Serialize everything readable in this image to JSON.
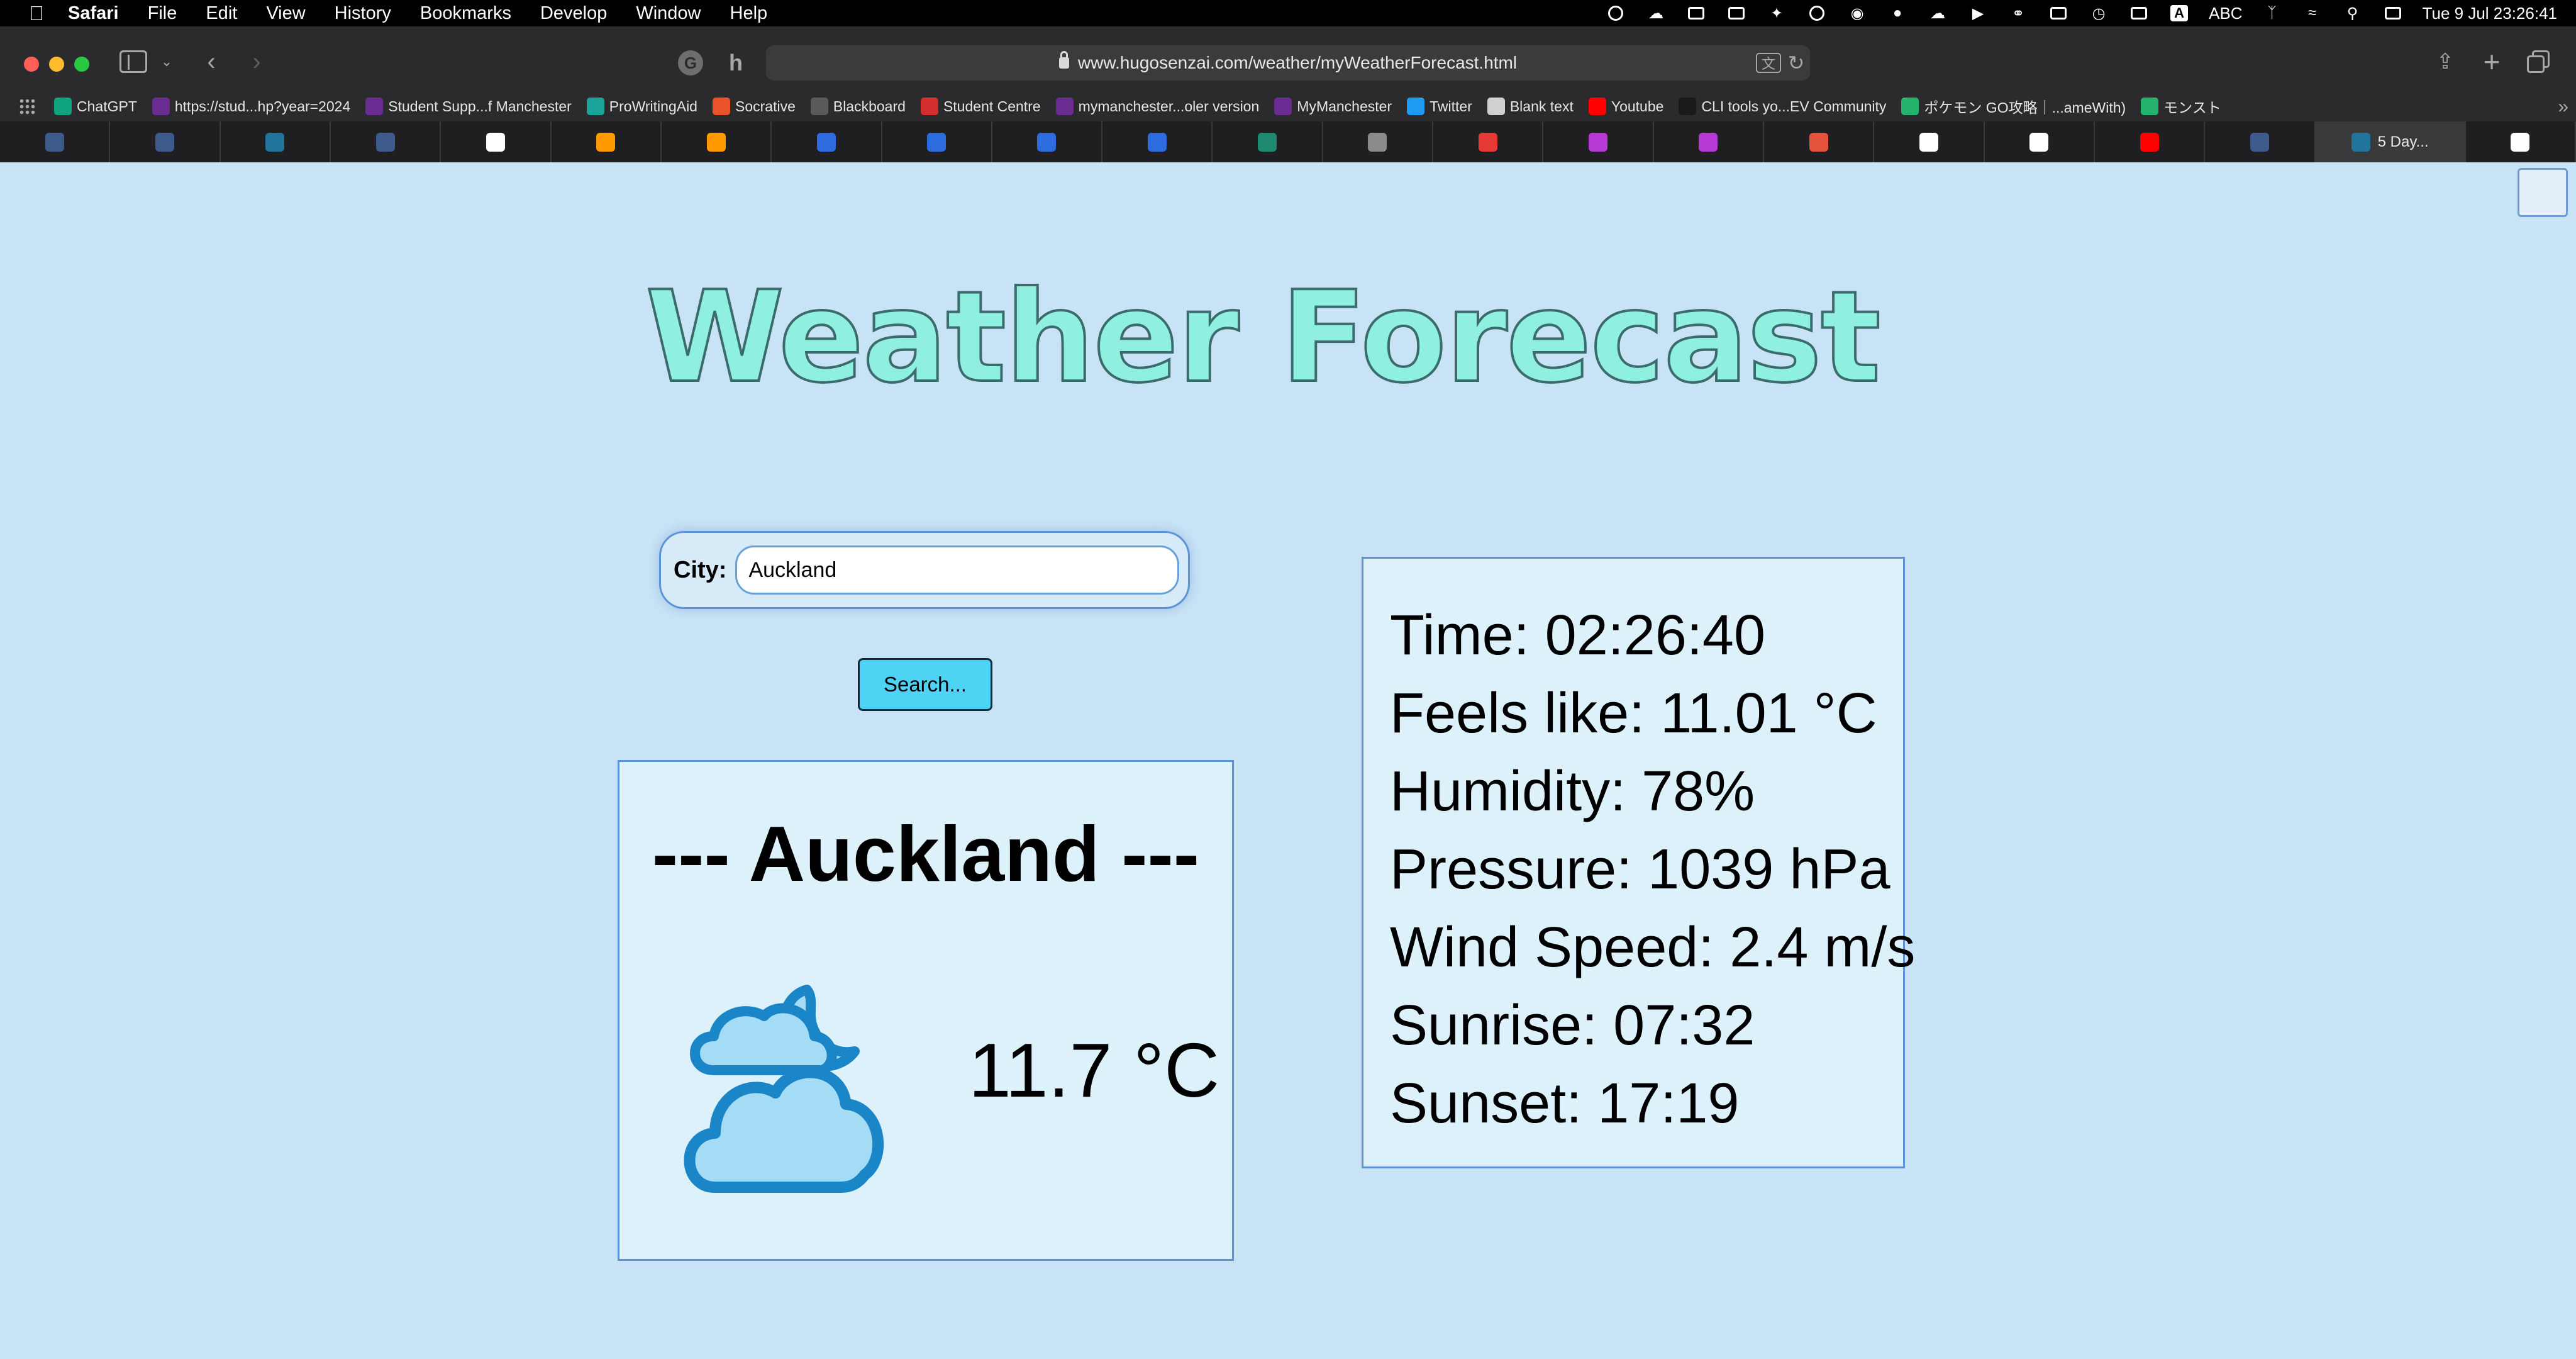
{
  "menubar": {
    "app_name": "Safari",
    "items": [
      "File",
      "Edit",
      "View",
      "History",
      "Bookmarks",
      "Develop",
      "Window",
      "Help"
    ],
    "status_icons": [
      "chatgpt-icon",
      "creative-cloud-icon",
      "document-icon",
      "display-icon",
      "feather-icon",
      "grammarly-icon",
      "vpn-icon",
      "user-icon",
      "cloud-icon",
      "play-icon",
      "headphones-icon",
      "screen-mirror-icon",
      "time-machine-icon",
      "battery-icon"
    ],
    "input_source": "ABC",
    "input_badge": "A",
    "datetime": "Tue 9 Jul  23:26:41"
  },
  "browser": {
    "url": "www.hugosenzai.com/weather/myWeatherForecast.html",
    "bookmarks": [
      {
        "label": "ChatGPT",
        "icon": "chatgpt-icon",
        "color": "#10a37f"
      },
      {
        "label": "https://stud...hp?year=2024",
        "icon": "manchester-m-icon",
        "color": "#6a2c91"
      },
      {
        "label": "Student Supp...f Manchester",
        "icon": "my-manchester-icon",
        "color": "#6a2c91"
      },
      {
        "label": "ProWritingAid",
        "icon": "prowritingaid-icon",
        "color": "#1aa39b"
      },
      {
        "label": "Socrative",
        "icon": "socrative-icon",
        "color": "#e8532a"
      },
      {
        "label": "Blackboard",
        "icon": "blackboard-icon",
        "color": "#5a5a5a"
      },
      {
        "label": "Student Centre",
        "icon": "student-centre-icon",
        "color": "#d32f2f"
      },
      {
        "label": "mymanchester...oler version",
        "icon": "manchester-m-icon",
        "color": "#6a2c91"
      },
      {
        "label": "MyManchester",
        "icon": "my-manchester-icon",
        "color": "#6a2c91"
      },
      {
        "label": "Twitter",
        "icon": "twitter-icon",
        "color": "#1d9bf0"
      },
      {
        "label": "Blank text",
        "icon": "blank-icon",
        "color": "#d0d0d0"
      },
      {
        "label": "Youtube",
        "icon": "youtube-icon",
        "color": "#ff0000"
      },
      {
        "label": "CLI tools yo...EV Community",
        "icon": "dev-icon",
        "color": "#1a1a1a"
      },
      {
        "label": "ポケモン GO攻略｜...ameWith)",
        "icon": "gamewith-icon",
        "color": "#26b36c"
      },
      {
        "label": "モンスト",
        "icon": "gamewith-icon",
        "color": "#26b36c"
      }
    ],
    "tabs": [
      {
        "icon": "generic-site-icon",
        "color": "#3c5a8a"
      },
      {
        "icon": "generic-site-icon",
        "color": "#3c5a8a"
      },
      {
        "icon": "wordpress-icon",
        "color": "#21759b"
      },
      {
        "icon": "generic-site-icon",
        "color": "#3c5a8a"
      },
      {
        "icon": "google-icon",
        "color": "#ffffff"
      },
      {
        "icon": "amazon-icon",
        "color": "#ff9900"
      },
      {
        "icon": "amazon-icon",
        "color": "#ff9900"
      },
      {
        "icon": "c-blue-icon",
        "color": "#2d6cdf"
      },
      {
        "icon": "c-blue-icon",
        "color": "#2d6cdf"
      },
      {
        "icon": "c-blue-icon",
        "color": "#2d6cdf"
      },
      {
        "icon": "c-blue-icon",
        "color": "#2d6cdf"
      },
      {
        "icon": "xl-icon",
        "color": "#1d8a70"
      },
      {
        "icon": "s-grey-icon",
        "color": "#8a8a8a"
      },
      {
        "icon": "red-arrow-icon",
        "color": "#e53935"
      },
      {
        "icon": "gradient-app-icon",
        "color": "#b83ad6"
      },
      {
        "icon": "gradient-app-icon",
        "color": "#b83ad6"
      },
      {
        "icon": "tool-red-icon",
        "color": "#e5533d"
      },
      {
        "icon": "google-icon",
        "color": "#ffffff"
      },
      {
        "icon": "github-icon",
        "color": "#ffffff"
      },
      {
        "icon": "youtube-icon",
        "color": "#ff0000"
      },
      {
        "icon": "generic-site-icon",
        "color": "#3c5a8a"
      }
    ],
    "active_tab": {
      "label": "5 Day...",
      "icon": "wordpress-icon",
      "color": "#21759b"
    },
    "last_tab": {
      "icon": "github-icon",
      "color": "#ffffff"
    }
  },
  "page": {
    "title": "Weather Forecast",
    "city_label": "City:",
    "city_value": "Auckland",
    "search_button": "Search...",
    "city_heading": "--- Auckland ---",
    "weather_icon": "cloudy-night-moon-icon",
    "temperature": "11.7 °C",
    "details": [
      "Time: 02:26:40",
      "Feels like: 11.01 °C",
      "Humidity: 78%",
      "Pressure: 1039 hPa",
      "Wind Speed: 2.4 m/s",
      "Sunrise: 07:32",
      "Sunset: 17:19"
    ],
    "colors": {
      "background": "#c9e3f6",
      "title_fill": "#8ff0e2",
      "card_bg": "#ddf1fb",
      "card_border": "#5b93d6",
      "button_bg": "#4fd3f4",
      "icon_stroke": "#1a86c8",
      "icon_fill": "#a5dcf5"
    }
  }
}
